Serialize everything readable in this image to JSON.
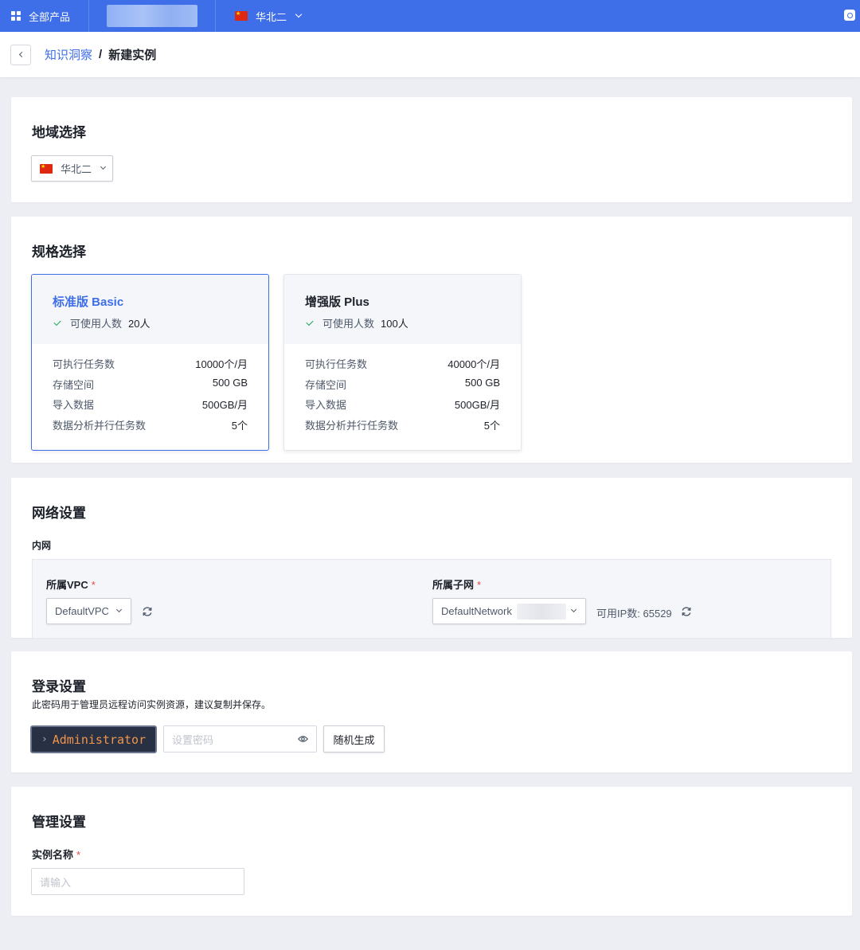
{
  "topbar": {
    "products_label": "全部产品",
    "region_label": "华北二"
  },
  "breadcrumb": {
    "parent": "知识洞察",
    "separator": "/",
    "current": "新建实例"
  },
  "region_section": {
    "title": "地域选择",
    "selected": "华北二"
  },
  "spec_section": {
    "title": "规格选择",
    "plans": [
      {
        "name": "标准版 Basic",
        "users_label": "可使用人数",
        "users_value": "20人",
        "selected": true,
        "rows": [
          {
            "k": "可执行任务数",
            "v": "10000个/月"
          },
          {
            "k": "存储空间",
            "v": "500 GB"
          },
          {
            "k": "导入数据",
            "v": "500GB/月"
          },
          {
            "k": "数据分析并行任务数",
            "v": "5个"
          }
        ]
      },
      {
        "name": "增强版 Plus",
        "users_label": "可使用人数",
        "users_value": "100人",
        "selected": false,
        "rows": [
          {
            "k": "可执行任务数",
            "v": "40000个/月"
          },
          {
            "k": "存储空间",
            "v": "500 GB"
          },
          {
            "k": "导入数据",
            "v": "500GB/月"
          },
          {
            "k": "数据分析并行任务数",
            "v": "5个"
          }
        ]
      }
    ]
  },
  "network_section": {
    "title": "网络设置",
    "subtitle": "内网",
    "vpc_label": "所属VPC",
    "vpc_value": "DefaultVPC",
    "subnet_label": "所属子网",
    "subnet_value": "DefaultNetwork",
    "ip_available": "可用IP数: 65529",
    "required_mark": "*"
  },
  "login_section": {
    "title": "登录设置",
    "description": "此密码用于管理员远程访问实例资源，建议复制并保存。",
    "user_button": "Administrator",
    "user_caret": "›",
    "password_placeholder": "设置密码",
    "random_button": "随机生成"
  },
  "manage_section": {
    "title": "管理设置",
    "name_label": "实例名称",
    "name_placeholder": "请输入",
    "required_mark": "*"
  },
  "colors": {
    "accent": "#3e6ee8",
    "required": "#e54545",
    "check": "#21a453"
  }
}
